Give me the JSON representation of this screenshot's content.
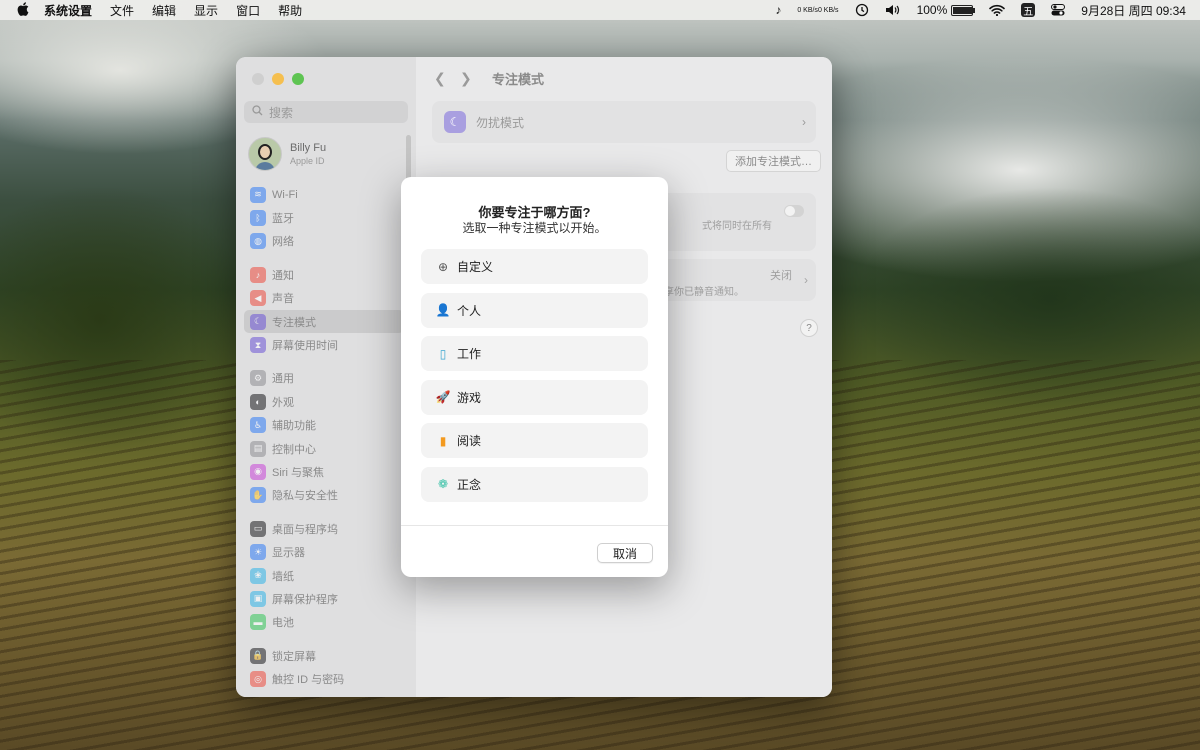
{
  "menubar": {
    "apple": "",
    "items": [
      "系统设置",
      "文件",
      "编辑",
      "显示",
      "窗口",
      "帮助"
    ],
    "net_up": "0 KB/s",
    "net_down": "0 KB/s",
    "battery": "100%",
    "battery_level": 1.0,
    "ime": "五",
    "datetime": "9月28日 周四  09:34"
  },
  "sidebar": {
    "search_placeholder": "搜索",
    "profile": {
      "name": "Billy Fu",
      "sub": "Apple ID"
    },
    "groups": [
      [
        {
          "label": "Wi‑Fi",
          "icon": "wifi-icon",
          "color": "#2f7cf6",
          "glyph": "≋"
        },
        {
          "label": "蓝牙",
          "icon": "bluetooth-icon",
          "color": "#2f7cf6",
          "glyph": "ᛒ"
        },
        {
          "label": "网络",
          "icon": "globe-icon",
          "color": "#2f7cf6",
          "glyph": "◍"
        }
      ],
      [
        {
          "label": "通知",
          "icon": "bell-icon",
          "color": "#ee4b3d",
          "glyph": "♪"
        },
        {
          "label": "声音",
          "icon": "speaker-icon",
          "color": "#ee4b3d",
          "glyph": "◀"
        },
        {
          "label": "专注模式",
          "icon": "moon-icon",
          "color": "#6b54d6",
          "glyph": "☾",
          "active": true
        },
        {
          "label": "屏幕使用时间",
          "icon": "hourglass-icon",
          "color": "#6b54d6",
          "glyph": "⧗"
        }
      ],
      [
        {
          "label": "通用",
          "icon": "gear-icon",
          "color": "#8e8e93",
          "glyph": "⚙"
        },
        {
          "label": "外观",
          "icon": "appearance-icon",
          "color": "#1c1c1e",
          "glyph": "◐"
        },
        {
          "label": "辅助功能",
          "icon": "accessibility-icon",
          "color": "#2f7cf6",
          "glyph": "♿"
        },
        {
          "label": "控制中心",
          "icon": "control-center-icon",
          "color": "#8e8e93",
          "glyph": "▤"
        },
        {
          "label": "Siri 与聚焦",
          "icon": "siri-icon",
          "color": "#c944d8",
          "glyph": "◉"
        },
        {
          "label": "隐私与安全性",
          "icon": "hand-icon",
          "color": "#2f7cf6",
          "glyph": "✋"
        }
      ],
      [
        {
          "label": "桌面与程序坞",
          "icon": "dock-icon",
          "color": "#1c1c1e",
          "glyph": "▭"
        },
        {
          "label": "显示器",
          "icon": "display-icon",
          "color": "#2f7cf6",
          "glyph": "☀"
        },
        {
          "label": "墙纸",
          "icon": "wallpaper-icon",
          "color": "#2fb4e8",
          "glyph": "❀"
        },
        {
          "label": "屏幕保护程序",
          "icon": "screensaver-icon",
          "color": "#2fb4e8",
          "glyph": "▣"
        },
        {
          "label": "电池",
          "icon": "battery-icon",
          "color": "#34c759",
          "glyph": "▬"
        }
      ],
      [
        {
          "label": "锁定屏幕",
          "icon": "lock-icon",
          "color": "#1c1c1e",
          "glyph": "🔒"
        },
        {
          "label": "触控 ID 与密码",
          "icon": "fingerprint-icon",
          "color": "#ee4b3d",
          "glyph": "◎"
        }
      ]
    ]
  },
  "content": {
    "title": "专注模式",
    "dnd_label": "勿扰模式",
    "add_button": "添加专注模式…",
    "share_text": "式将同时在所有",
    "status_off": "关闭",
    "status_desc": "共享你已静音通知。",
    "help": "?"
  },
  "dialog": {
    "title": "你要专注于哪方面?",
    "subtitle": "选取一种专注模式以开始。",
    "options": [
      {
        "label": "自定义",
        "icon": "plus-circle-icon",
        "color": "#555555",
        "glyph": "⊕"
      },
      {
        "label": "个人",
        "icon": "person-icon",
        "color": "#a24bd9",
        "glyph": "👤"
      },
      {
        "label": "工作",
        "icon": "badge-icon",
        "color": "#3aa6d0",
        "glyph": "▯"
      },
      {
        "label": "游戏",
        "icon": "rocket-icon",
        "color": "#2f7cf6",
        "glyph": "🚀"
      },
      {
        "label": "阅读",
        "icon": "book-icon",
        "color": "#f39a1f",
        "glyph": "▮"
      },
      {
        "label": "正念",
        "icon": "flower-icon",
        "color": "#3cc2a8",
        "glyph": "❁"
      }
    ],
    "cancel": "取消"
  }
}
